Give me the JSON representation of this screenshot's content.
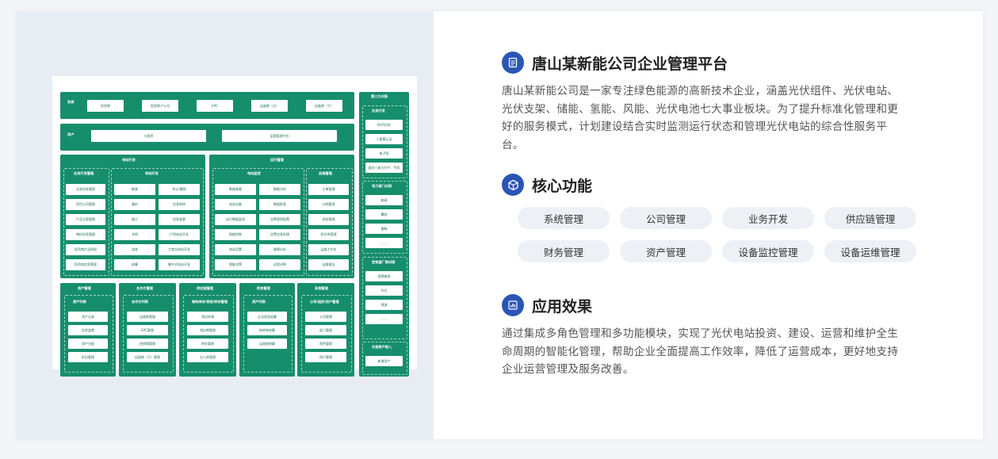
{
  "platform": {
    "title": "唐山某新能公司企业管理平台",
    "description": "唐山某新能公司是一家专注绿色能源的高新技术企业，涵盖光伏组件、光伏电站、光伏支架、储能、氢能、风能、光伏电池七大事业板块。为了提升标准化管理和更好的服务模式，计划建设结合实时监测运行状态和管理光伏电站的综合性服务平台。"
  },
  "features": {
    "title": "核心功能",
    "items": [
      "系统管理",
      "公司管理",
      "业务开发",
      "供应链管理",
      "财务管理",
      "资产管理",
      "设备监控管理",
      "设备运维管理"
    ]
  },
  "effect": {
    "title": "应用效果",
    "description": "通过集成多角色管理和多功能模块，实现了光伏电站投资、建设、运营和维护全生命周期的智能化管理，帮助企业全面提高工作效率，降低了运营成本，更好地支持企业运营管理及服务改善。"
  },
  "icons": {
    "platform": "document-icon",
    "features": "cube-icon",
    "effect": "bar-chart-icon"
  },
  "colors": {
    "accent": "#2a55b5",
    "diagram_green": "#168e6c",
    "pill_bg": "#edf1f6"
  },
  "diagram": {
    "row1": {
      "label": "系统\n用户",
      "items": [
        "投资商",
        "投资商子公司",
        "EPC",
        "运维商（方）",
        "运维商（子）"
      ]
    },
    "row2": {
      "label": "用户\n登记",
      "items": [
        "小程序",
        "运营管理平台"
      ]
    },
    "dev": {
      "title": "电站开发",
      "left": {
        "title": "业务开发管理",
        "items": [
          "业务信息管理",
          "项目公司管理",
          "产品方案管理",
          "物料信息管理",
          "投资商产品授权",
          "投资商信息管理"
        ]
      },
      "right": {
        "title": "电站开发",
        "col1": [
          "勘查",
          "备料",
          "施工",
          "并网",
          "验收",
          "结算"
        ],
        "col2": [
          "终止/撤销",
          "信息审核",
          "信息变更",
          "户用电站开发",
          "工商业电站开发",
          "集中式电站开发"
        ]
      }
    },
    "ops": {
      "title": "运行管理",
      "left": {
        "title": "电站监控",
        "col1": [
          "数据查看",
          "电站设备",
          "运行数据监测",
          "智能控制",
          "电站设置",
          "智能决策"
        ],
        "col2": [
          "数据分析",
          "数据报表",
          "告警规则配置",
          "告警信息处理",
          "故障分析",
          "远程诊断"
        ]
      },
      "right": {
        "title": "运维管理",
        "items": [
          "工单管理",
          "计划管理",
          "巡检管理",
          "知识库管理",
          "运维工作台",
          "运维报告"
        ]
      }
    },
    "bottom": [
      {
        "title": "资产管理",
        "sub": "资产列表",
        "items": [
          "资产记录",
          "信息变更",
          "资产分配",
          "折旧管理"
        ]
      },
      {
        "title": "合作方管理",
        "sub": "合作方列表",
        "items": [
          "运维商管理",
          "EPC管理",
          "经销商管理",
          "运维商（子）管理"
        ]
      },
      {
        "title": "供应链管理",
        "sub": "物料库存/领用/库存管理",
        "items": [
          "领出申请",
          "领出审管理",
          "库存管理",
          "出入库管理"
        ]
      },
      {
        "title": "财务管理",
        "sub": "资产列表",
        "items": [
          "企业现金结算",
          "结转单结算",
          "运维商结算"
        ]
      },
      {
        "title": "系统管理",
        "sub": "公司/组织/用户管理",
        "items": [
          "公司管理",
          "部门管理",
          "角色管理",
          "用户管理"
        ]
      }
    ],
    "side": {
      "title": "第三方对接",
      "groups": [
        {
          "title": "业务开发",
          "items": [
            "OCR识别",
            "三要素认证",
            "电子签",
            "面向三维卡开户、代扣"
          ]
        },
        {
          "title": "电力部门对接",
          "items": [
            "能源",
            "翼锐",
            "美畅",
            "......"
          ]
        },
        {
          "title": "逆变器厂商对接",
          "items": [
            "固德威逆",
            "华为",
            "锦浪",
            "......"
          ]
        },
        {
          "title": "外部资产接入",
          "items": [
            "新增资产"
          ]
        }
      ]
    }
  }
}
